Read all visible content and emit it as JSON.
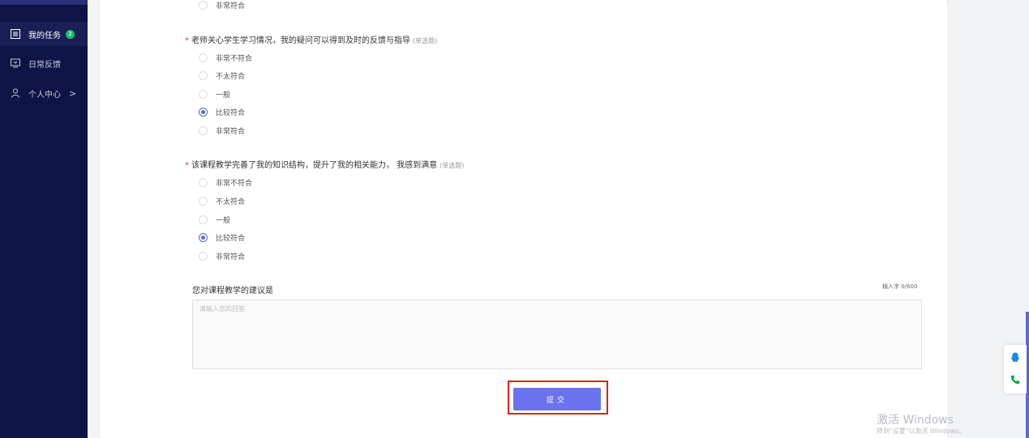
{
  "sidebar": {
    "items": [
      {
        "label": "我的任务",
        "badge": "2",
        "icon": "list-icon"
      },
      {
        "label": "日常反馈",
        "icon": "monitor-icon"
      },
      {
        "label": "个人中心",
        "icon": "user-icon",
        "chevron": ">"
      }
    ]
  },
  "top_option": "非常符合",
  "questions": [
    {
      "title": "老师关心学生学习情况，我的疑问可以得到及时的反馈与指导",
      "required": "*",
      "type_tag": "(单选题)",
      "options": [
        "非常不符合",
        "不太符合",
        "一般",
        "比较符合",
        "非常符合"
      ],
      "selected": "比较符合"
    },
    {
      "title": "该课程教学完善了我的知识结构，提升了我的相关能力， 我感到满意",
      "required": "*",
      "type_tag": "(单选题)",
      "options": [
        "非常不符合",
        "不太符合",
        "一般",
        "比较符合",
        "非常符合"
      ],
      "selected": "比较符合"
    }
  ],
  "suggestion": {
    "label": "您对课程教学的建议是",
    "counter": "输入字 0/600",
    "placeholder": "请输入您的回答"
  },
  "submit_label": "提交",
  "watermark": {
    "line1": "激活 Windows",
    "line2": "转到\"设置\"以激活 Windows。"
  },
  "colors": {
    "sidebar_bg": "#0f1446",
    "accent": "#6b73ef",
    "required": "#ed4014",
    "badge": "#19be6b",
    "highlight": "#e0201c"
  }
}
